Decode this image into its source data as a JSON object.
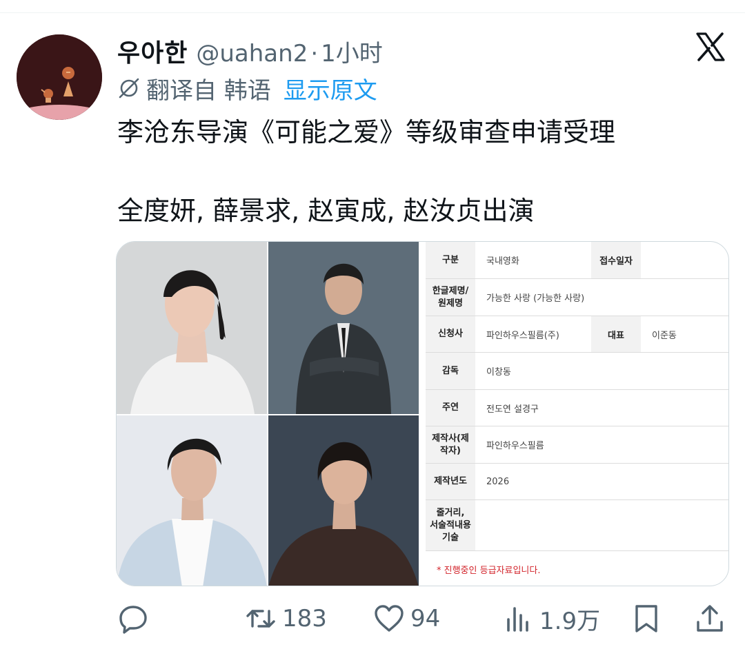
{
  "author": {
    "display_name": "우아한",
    "handle": "@uahan2",
    "separator": "·",
    "time": "1小时"
  },
  "translation": {
    "label": "翻译自 韩语",
    "show_original": "显示原文"
  },
  "tweet": {
    "line1": "李沧东导演《可能之爱》等级审查申请受理",
    "line2": "全度妍, 薛景求, 赵寅成, 赵汝贞出演"
  },
  "form": {
    "row1": {
      "label": "구분",
      "value": "국내영화",
      "label2": "접수일자",
      "value2": ""
    },
    "row2": {
      "label": "한글제명/\n원제명",
      "value": "가능한 사랑 (가능한 사랑)"
    },
    "row3": {
      "label": "신청사",
      "value": "파인하우스필름(주)",
      "label2": "대표",
      "value2": "이준동"
    },
    "row4": {
      "label": "감독",
      "value": "이창동"
    },
    "row5": {
      "label": "주연",
      "value": "전도연 설경구"
    },
    "row6": {
      "label": "제작사(제\n작자)",
      "value": "파인하우스필름"
    },
    "row7": {
      "label": "제작년도",
      "value": "2026"
    },
    "row8": {
      "label": "줄거리,\n서술적내용\n기술",
      "value": ""
    },
    "note": "* 진행중인 등급자료입니다."
  },
  "actions": {
    "reply_count": "",
    "retweet_count": "183",
    "like_count": "94",
    "views_count": "1.9万"
  },
  "colors": {
    "accent": "#1d9bf0",
    "muted": "#536471",
    "text": "#0f1419",
    "note_red": "#d2232a"
  },
  "icons": [
    "x-logo-icon",
    "translate-icon",
    "reply-icon",
    "retweet-icon",
    "like-icon",
    "views-icon",
    "bookmark-icon",
    "share-icon"
  ]
}
